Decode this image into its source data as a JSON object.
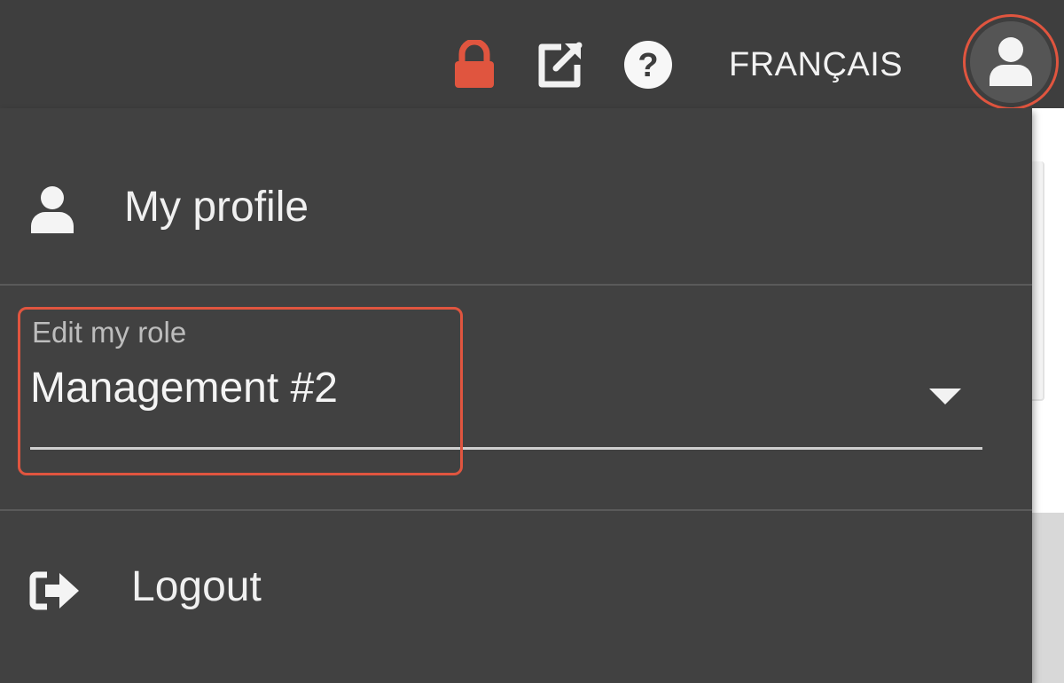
{
  "header": {
    "lock_icon": "lock-icon",
    "external_link_icon": "external-link-icon",
    "help_icon": "help-icon",
    "language_label": "FRANÇAIS",
    "avatar_icon": "user-icon",
    "lock_color": "#e0553f",
    "highlight_color": "#e0553f"
  },
  "menu": {
    "profile_label": "My profile",
    "role_label": "Edit my role",
    "role_value": "Management #2",
    "logout_label": "Logout"
  }
}
